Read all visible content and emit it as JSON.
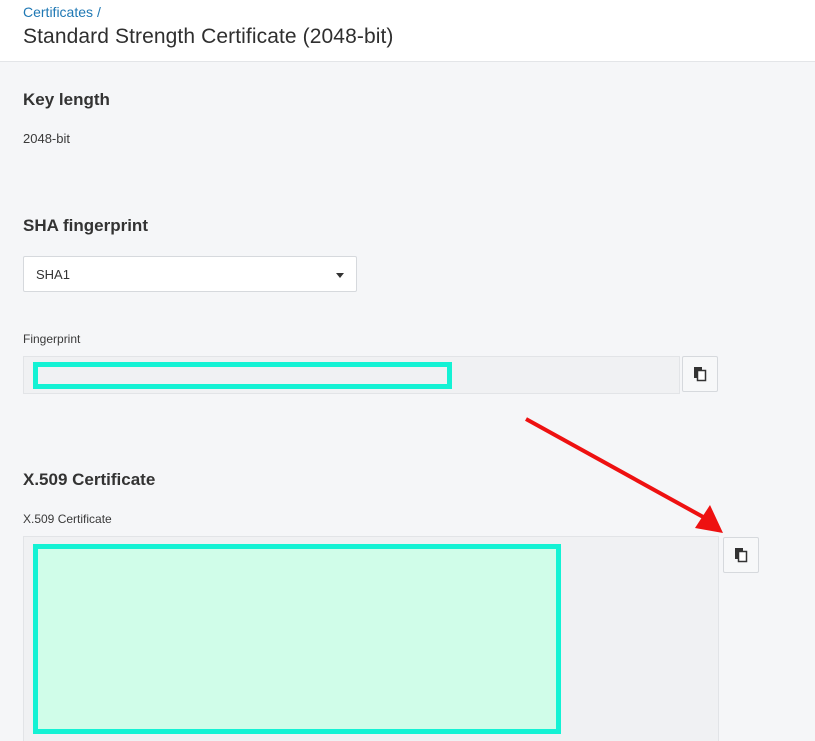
{
  "header": {
    "breadcrumb_link": "Certificates",
    "breadcrumb_sep": "/",
    "title": "Standard Strength Certificate (2048-bit)"
  },
  "key_length": {
    "heading": "Key length",
    "value": "2048-bit"
  },
  "sha": {
    "heading": "SHA fingerprint",
    "select_value": "SHA1",
    "fingerprint_label": "Fingerprint"
  },
  "x509": {
    "heading": "X.509 Certificate",
    "label": "X.509 Certificate"
  },
  "icons": {
    "copy": "copy-icon",
    "dropdown": "chevron-down-icon"
  },
  "colors": {
    "link": "#1f78b4",
    "redaction": "#14f2d4",
    "annotation_arrow": "#ee1111"
  }
}
